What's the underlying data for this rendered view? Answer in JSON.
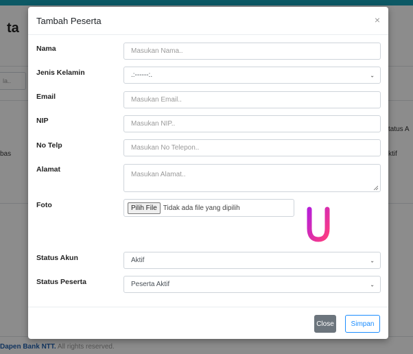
{
  "background": {
    "page_title_fragment": "ta",
    "search_fragment": "la..",
    "row_left_fragment": "bas",
    "col_header_fragment": "tatus A",
    "cell_fragment": "ktif",
    "footer": {
      "brand": "Dapen Bank NTT.",
      "rest": " All rights reserved."
    }
  },
  "modal": {
    "title": "Tambah Peserta",
    "close_symbol": "×",
    "fields": {
      "nama": {
        "label": "Nama",
        "placeholder": "Masukan Nama.."
      },
      "jenis_kelamin": {
        "label": "Jenis Kelamin",
        "value": ".:------:."
      },
      "email": {
        "label": "Email",
        "placeholder": "Masukan Email.."
      },
      "nip": {
        "label": "NIP",
        "placeholder": "Masukan NIP.."
      },
      "no_telp": {
        "label": "No Telp",
        "placeholder": "Masukan No Telepon.."
      },
      "alamat": {
        "label": "Alamat",
        "placeholder": "Masukan Alamat.."
      },
      "foto": {
        "label": "Foto",
        "button": "Pilih File",
        "status": "Tidak ada file yang dipilih"
      },
      "status_akun": {
        "label": "Status Akun",
        "value": "Aktif"
      },
      "status_peserta": {
        "label": "Status Peserta",
        "value": "Peserta Aktif"
      }
    },
    "buttons": {
      "close": "Close",
      "save": "Simpan"
    }
  },
  "colors": {
    "topbar": "#17a2b8",
    "primary": "#1a8cff",
    "secondary": "#6c757d",
    "logo_gradient_start": "#b81fd6",
    "logo_gradient_end": "#ff3d7f"
  },
  "icons": {
    "chevron": "chevron-down-icon",
    "logo": "u-logo-icon"
  }
}
